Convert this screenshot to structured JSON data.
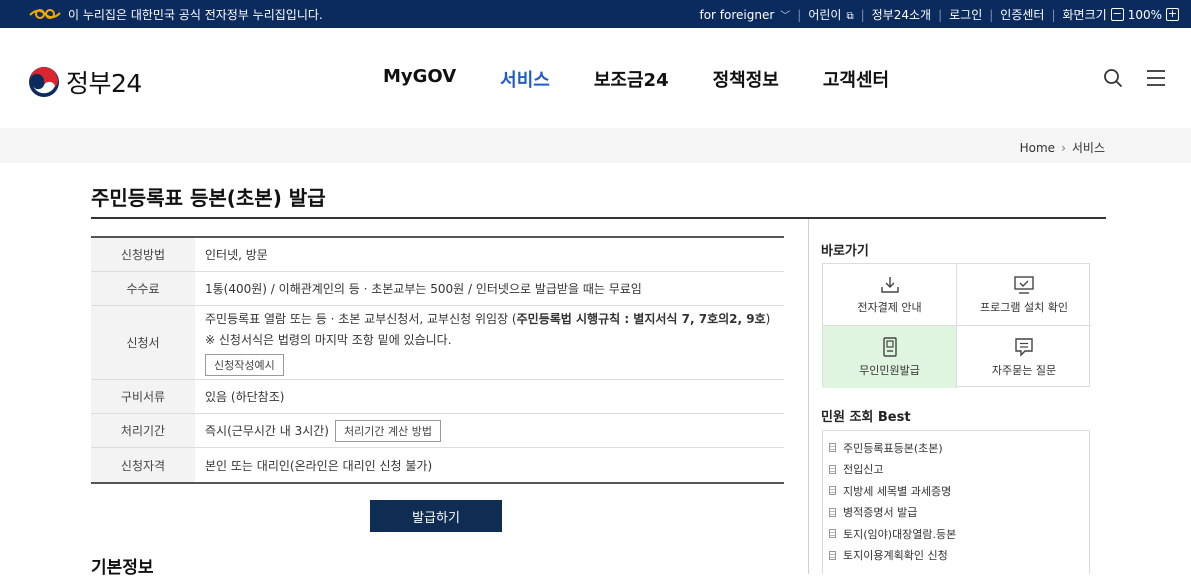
{
  "topbar": {
    "notice": "이 누리집은 대한민국 공식 전자정부 누리집입니다.",
    "links": [
      "for foreigner",
      "어린이",
      "정부24소개",
      "로그인",
      "인증센터"
    ],
    "zoom_label": "화면크기",
    "zoom_value": "100%"
  },
  "header": {
    "logo_text": "정부24",
    "nav": [
      "MyGOV",
      "서비스",
      "보조금24",
      "정책정보",
      "고객센터"
    ],
    "active_nav": "서비스"
  },
  "breadcrumb": {
    "home": "Home",
    "current": "서비스"
  },
  "page": {
    "title": "주민등록표 등본(초본) 발급",
    "issue_button": "발급하기",
    "next_heading": "기본정보"
  },
  "info_table": {
    "method": {
      "label": "신청방법",
      "value": "인터넷, 방문"
    },
    "fee": {
      "label": "수수료",
      "value": "1통(400원) / 이해관계인의 등 · 초본교부는 500원 / 인터넷으로 발급받을 때는 무료임"
    },
    "form": {
      "label": "신청서",
      "line1_pre": "주민등록표 열람 또는 등 · 초본 교부신청서, 교부신청 위임장 (",
      "line1_bold": "주민등록법 시행규칙 : 별지서식 7, 7호의2, 9호",
      "line1_post": ")",
      "line2": "※ 신청서식은 법령의 마지막 조항 밑에 있습니다.",
      "button": "신청작성예시"
    },
    "docs": {
      "label": "구비서류",
      "value": "있음 (하단참조)"
    },
    "period": {
      "label": "처리기간",
      "value": "즉시(근무시간 내 3시간)",
      "button": "처리기간 계산 방법"
    },
    "eligibility": {
      "label": "신청자격",
      "value": "본인 또는 대리인(온라인은 대리인 신청 불가)"
    }
  },
  "quick_links": {
    "title": "바로가기",
    "items": [
      "전자결제 안내",
      "프로그램 설치 확인",
      "무인민원발급",
      "자주묻는 질문"
    ]
  },
  "best": {
    "title": "민원 조회 Best",
    "items": [
      "주민등록표등본(초본)",
      "전입신고",
      "지방세 세목별 과세증명",
      "병적증명서 발급",
      "토지(임야)대장열람.등본",
      "토지이용계획확인 신청"
    ]
  },
  "colors": {
    "topbar": "#0b2b5e",
    "active_nav": "#1f5ec8",
    "issue_button": "#0f2d52",
    "highlight": "#dff5e0"
  }
}
